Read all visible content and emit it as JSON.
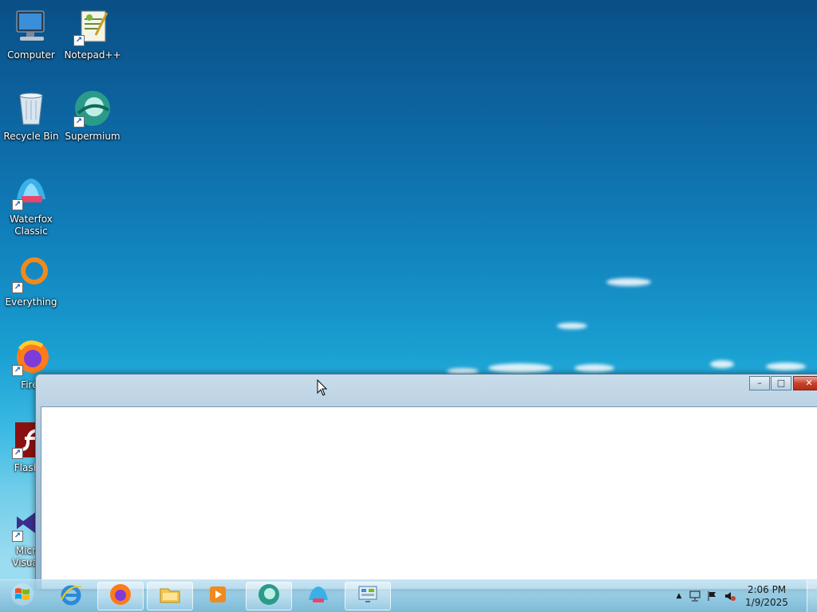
{
  "desktop": {
    "icons": [
      {
        "label": "Computer",
        "icon": "computer-icon"
      },
      {
        "label": "Notepad++",
        "icon": "notepadpp-icon"
      },
      {
        "label": "Recycle Bin",
        "icon": "recycle-bin-icon"
      },
      {
        "label": "Supermium",
        "icon": "supermium-icon"
      },
      {
        "label": "Waterfox Classic",
        "icon": "waterfox-icon"
      },
      {
        "label": "Everything",
        "icon": "everything-icon"
      },
      {
        "label": "Firef",
        "icon": "firefox-icon"
      },
      {
        "label": "Flash P",
        "icon": "flash-player-icon"
      },
      {
        "label": "Micros Visual S",
        "icon": "visual-studio-icon"
      }
    ]
  },
  "window": {
    "title": "",
    "buttons": {
      "minimize": "–",
      "maximize": "□",
      "close": "✕"
    }
  },
  "taskbar": {
    "start_icon": "windows-start-icon",
    "pinned": [
      {
        "name": "internet-explorer",
        "icon": "ie-icon"
      },
      {
        "name": "firefox",
        "icon": "firefox-icon"
      },
      {
        "name": "file-explorer",
        "icon": "folder-icon"
      },
      {
        "name": "media-player",
        "icon": "media-player-icon"
      },
      {
        "name": "supermium",
        "icon": "supermium-icon"
      },
      {
        "name": "waterfox",
        "icon": "waterfox-icon"
      },
      {
        "name": "control-panel",
        "icon": "control-panel-icon"
      }
    ],
    "clock": {
      "time": "2:06 PM",
      "date": "1/9/2025"
    }
  },
  "colors": {
    "close_button": "#c8412b",
    "taskbar": "#8cc4de",
    "window_frame": "#a9c5db"
  }
}
